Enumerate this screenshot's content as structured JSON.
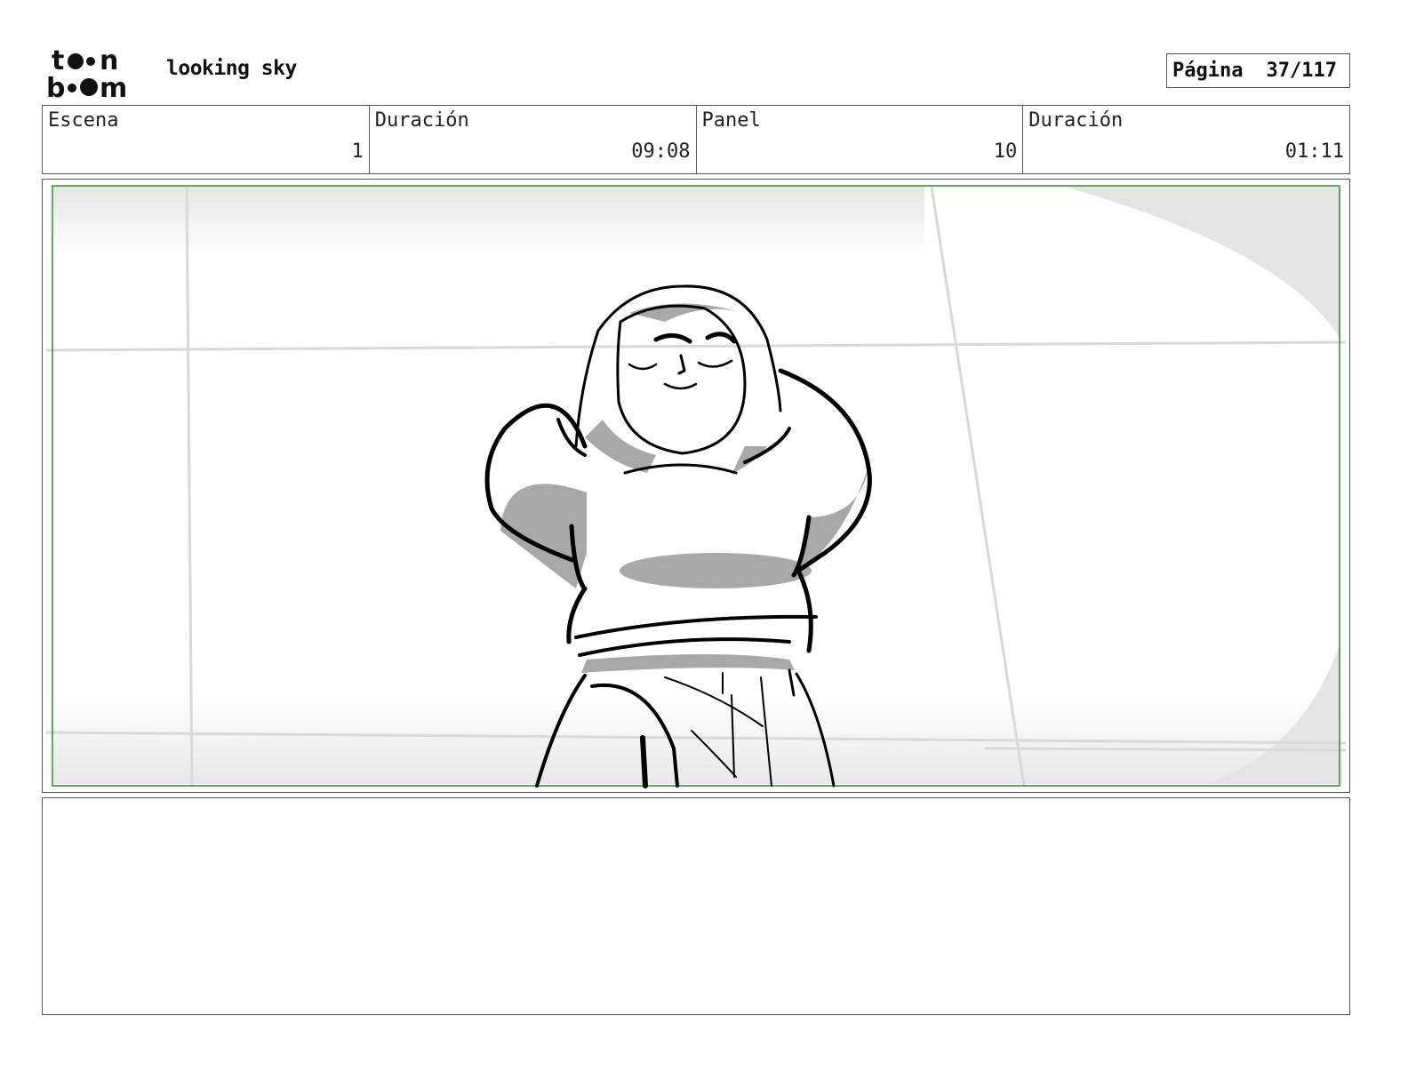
{
  "header": {
    "title": "looking sky",
    "page_label": "Página",
    "page_value": "37/117"
  },
  "info": {
    "scene_label": "Escena",
    "scene_value": "1",
    "scene_duration_label": "Duración",
    "scene_duration_value": "09:08",
    "panel_label": "Panel",
    "panel_value": "10",
    "panel_duration_label": "Duración",
    "panel_duration_value": "01:11"
  },
  "colors": {
    "safe_frame": "#2e8b2e",
    "shadow": "#a8a8a8",
    "ink": "#000000"
  },
  "icons": {
    "logo": "toon-boom-logo"
  }
}
